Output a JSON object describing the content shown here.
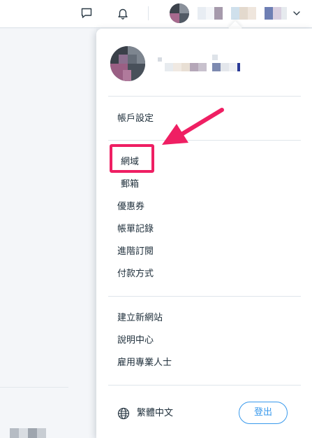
{
  "topbar": {
    "icons": [
      "chat-icon",
      "bell-icon",
      "chevron-down-icon"
    ],
    "user_name_blurred": true
  },
  "dropdown": {
    "account_settings": "帳戶設定",
    "domains": "網域",
    "mailboxes": "郵箱",
    "coupons": "優惠券",
    "billing_history": "帳單記錄",
    "premium": "進階訂閱",
    "payment_methods": "付款方式",
    "create_site": "建立新網站",
    "help_center": "說明中心",
    "hire_pro": "雇用專業人士",
    "language": "繁體中文",
    "logout": "登出"
  },
  "colors": {
    "accent": "#3899ec",
    "annotation": "#ef1f63",
    "text": "#20303c"
  }
}
